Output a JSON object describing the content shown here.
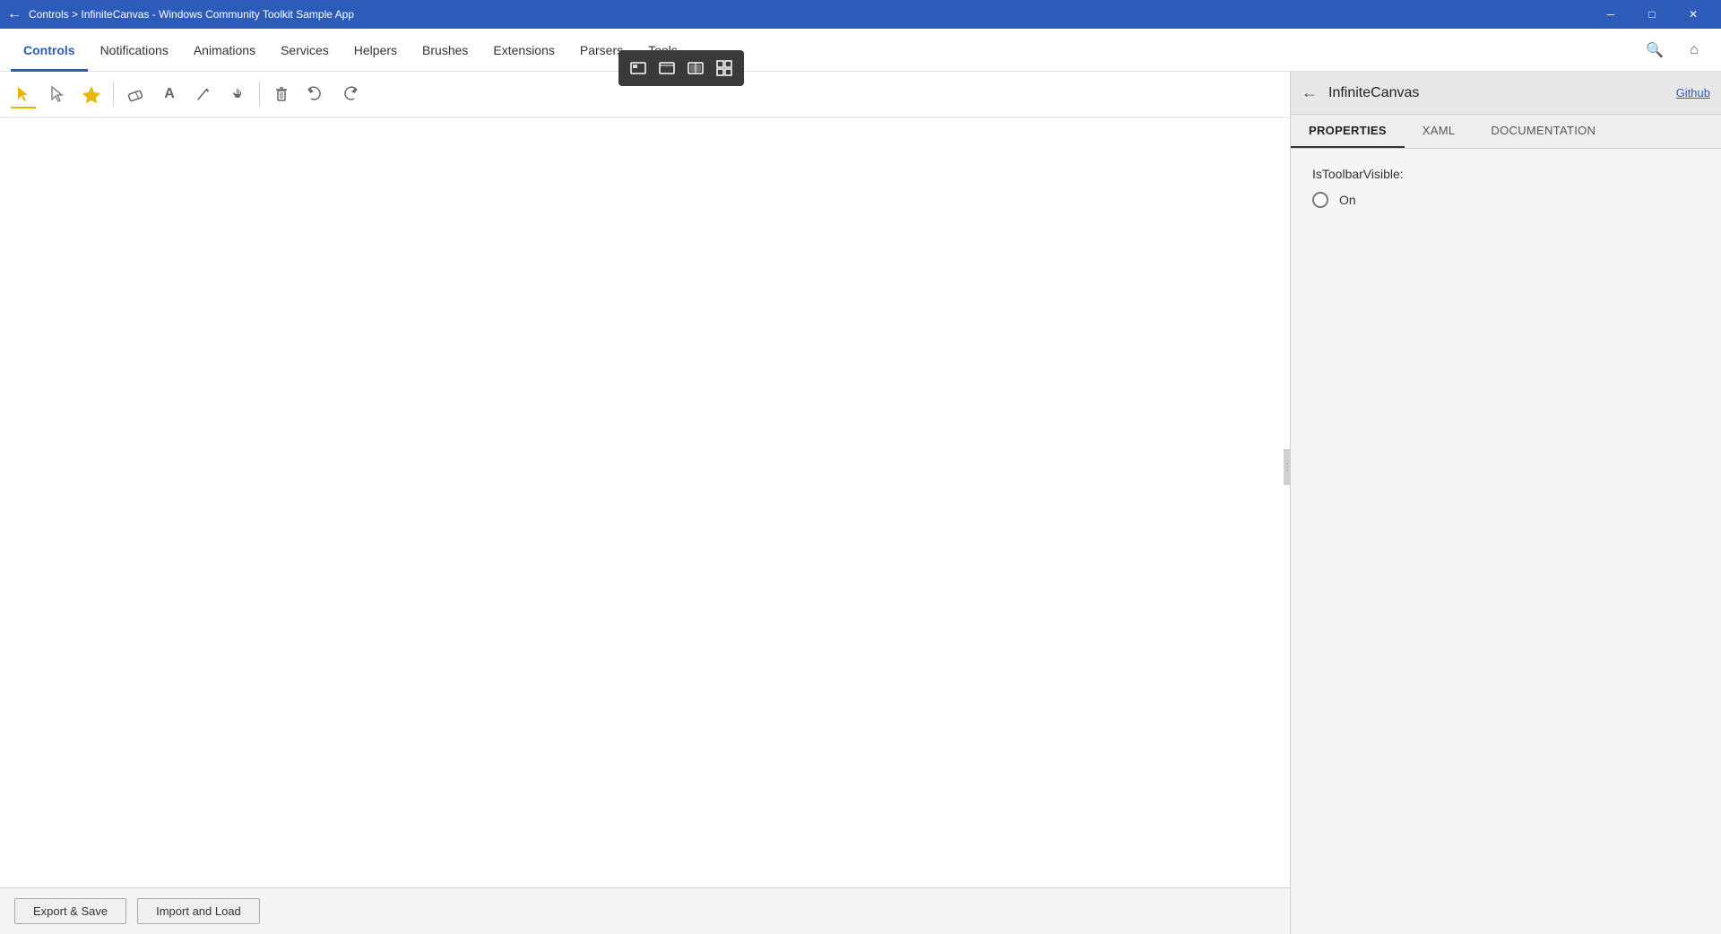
{
  "titlebar": {
    "title": "Controls > InfiniteCanvas - Windows Community Toolkit Sample App",
    "minimize": "─",
    "maximize": "□",
    "close": "✕"
  },
  "menubar": {
    "items": [
      {
        "id": "controls",
        "label": "Controls",
        "active": true
      },
      {
        "id": "notifications",
        "label": "Notifications",
        "active": false
      },
      {
        "id": "animations",
        "label": "Animations",
        "active": false
      },
      {
        "id": "services",
        "label": "Services",
        "active": false
      },
      {
        "id": "helpers",
        "label": "Helpers",
        "active": false
      },
      {
        "id": "brushes",
        "label": "Brushes",
        "active": false
      },
      {
        "id": "extensions",
        "label": "Extensions",
        "active": false
      },
      {
        "id": "parsers",
        "label": "Parsers",
        "active": false
      },
      {
        "id": "tools",
        "label": "Tools",
        "active": false
      }
    ],
    "search_icon": "🔍",
    "home_icon": "⌂"
  },
  "floating_toolbar": {
    "buttons": [
      {
        "id": "ft-btn1",
        "icon": "⊞"
      },
      {
        "id": "ft-btn2",
        "icon": "⬜"
      },
      {
        "id": "ft-btn3",
        "icon": "⬛"
      },
      {
        "id": "ft-btn4",
        "icon": "▣"
      }
    ]
  },
  "canvas_toolbar": {
    "tools": [
      {
        "id": "tool-select",
        "icon": "▽",
        "active": true,
        "label": "Select"
      },
      {
        "id": "tool-node",
        "icon": "▽",
        "active": false,
        "outline": true,
        "label": "Node Select"
      },
      {
        "id": "tool-highlight",
        "icon": "△",
        "active": false,
        "yellow": true,
        "label": "Highlight"
      },
      {
        "id": "tool-eraser",
        "icon": "◇",
        "active": false,
        "label": "Eraser"
      },
      {
        "id": "tool-text",
        "icon": "A",
        "active": false,
        "label": "Text"
      },
      {
        "id": "tool-pen",
        "icon": "✏",
        "active": false,
        "label": "Pen"
      },
      {
        "id": "tool-touch",
        "icon": "✋",
        "active": false,
        "label": "Touch"
      }
    ],
    "actions": [
      {
        "id": "action-delete",
        "icon": "🗑",
        "label": "Delete"
      },
      {
        "id": "action-undo",
        "icon": "↩",
        "label": "Undo"
      },
      {
        "id": "action-redo",
        "icon": "↪",
        "label": "Redo"
      }
    ]
  },
  "bottom_bar": {
    "export_label": "Export & Save",
    "import_label": "Import and Load"
  },
  "right_panel": {
    "title": "InfiniteCanvas",
    "github_label": "Github",
    "tabs": [
      {
        "id": "properties",
        "label": "PROPERTIES",
        "active": true
      },
      {
        "id": "xaml",
        "label": "XAML",
        "active": false
      },
      {
        "id": "documentation",
        "label": "DOCUMENTATION",
        "active": false
      }
    ],
    "properties": {
      "toolbar_visible_label": "IsToolbarVisible:",
      "toggle_value": "On"
    }
  }
}
